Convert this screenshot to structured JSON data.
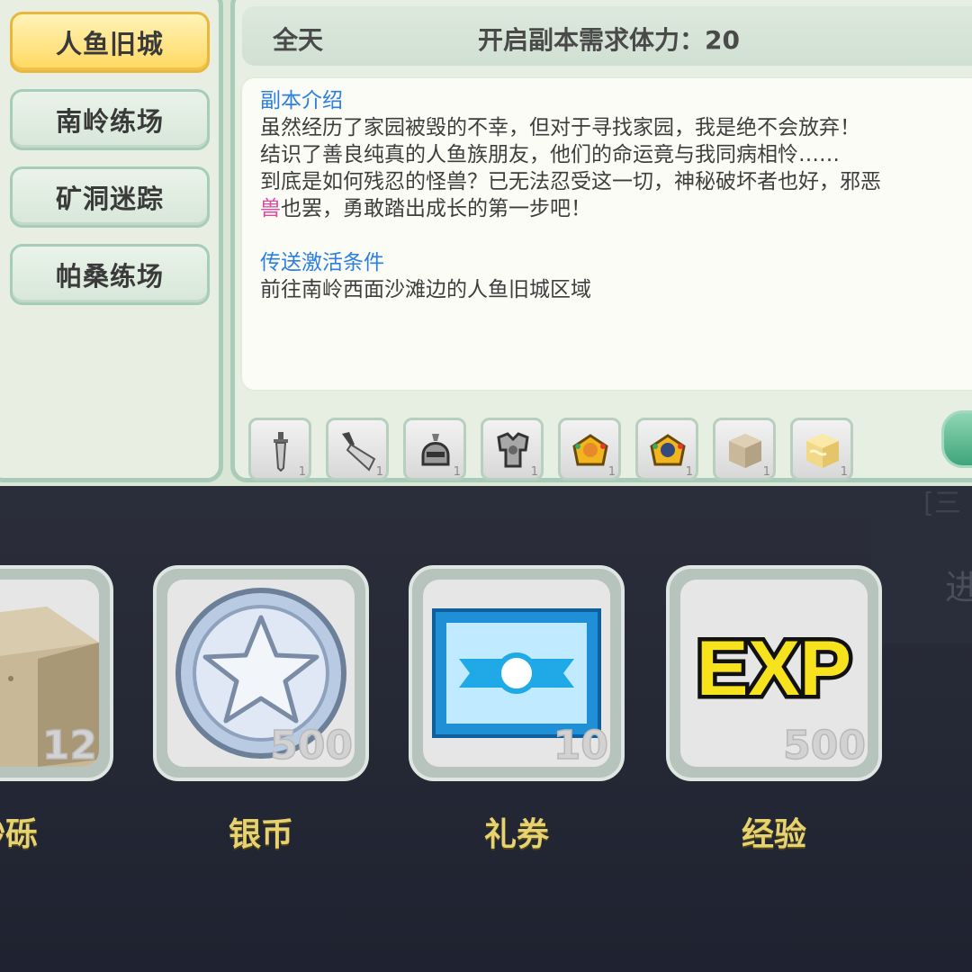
{
  "top": {
    "sidebar": {
      "items": [
        {
          "label": "人鱼旧城",
          "active": true
        },
        {
          "label": "南岭练场",
          "active": false
        },
        {
          "label": "矿洞迷踪",
          "active": false
        },
        {
          "label": "帕桑练场",
          "active": false
        }
      ]
    },
    "header": {
      "day": "全天",
      "cost": "开启副本需求体力：20"
    },
    "description": {
      "intro_title": "副本介绍",
      "intro_line1": "虽然经历了家园被毁的不幸，但对于寻找家园，我是绝不会放弃！",
      "intro_line2": "结识了善良纯真的人鱼族朋友，他们的命运竟与我同病相怜……",
      "intro_line3": "到底是如何残忍的怪兽？已无法忍受这一切，神秘破坏者也好，邪恶",
      "intro_line4_pink": "兽",
      "intro_line4_rest": "也罢，勇敢踏出成长的第一步吧！",
      "teleport_title": "传送激活条件",
      "teleport_text": "前往南岭西面沙滩边的人鱼旧城区域"
    },
    "loot": [
      {
        "icon": "dagger-icon",
        "count": "1"
      },
      {
        "icon": "cleaver-icon",
        "count": "1"
      },
      {
        "icon": "helmet-icon",
        "count": "1"
      },
      {
        "icon": "armor-icon",
        "count": "1"
      },
      {
        "icon": "gold-chest-orange-icon",
        "count": "1"
      },
      {
        "icon": "gold-chest-blue-icon",
        "count": "1"
      },
      {
        "icon": "sand-block-icon",
        "count": "1"
      },
      {
        "icon": "sandstone-block-icon",
        "count": "1"
      }
    ]
  },
  "bottom": {
    "rewards": [
      {
        "icon": "sand-block-icon",
        "amount": "12",
        "label": "砂砾"
      },
      {
        "icon": "silver-coin-icon",
        "amount": "500",
        "label": "银币"
      },
      {
        "icon": "gift-voucher-icon",
        "amount": "10",
        "label": "礼券"
      },
      {
        "icon": "exp-icon",
        "amount": "500",
        "label": "经验"
      }
    ],
    "edge_text": "进",
    "edge_top": "[三"
  }
}
